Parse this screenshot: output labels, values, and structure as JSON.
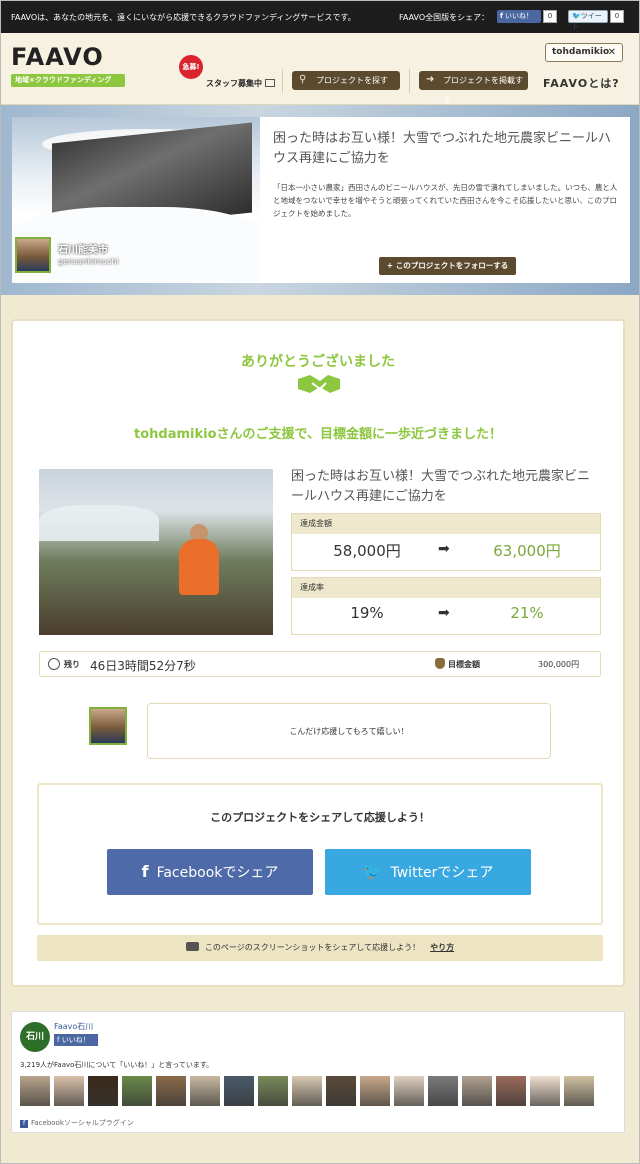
{
  "topbar": {
    "tagline": "FAAVOは、あなたの地元を、遠くにいながら応援できるクラウドファンディングサービスです。",
    "share_label": "FAAVO全国版をシェア：",
    "fb_like": "いいね！",
    "fb_count": "0",
    "tweet": "ツイート",
    "tweet_count": "0"
  },
  "header": {
    "logo": "FAAVO",
    "logo_sub": "地域×クラウドファンディング",
    "badge": "急募!",
    "staff": "スタッフ募集中",
    "find_project": "プロジェクトを探す",
    "post_project": "プロジェクトを掲載する",
    "user": "tohdamikio",
    "close": "✕",
    "faavo_what": "FAAVOとは?"
  },
  "hero": {
    "title": "困った時はお互い様！大雪でつぶれた地元農家ビニールハウス再建にご協力を",
    "description": "「日本一小さい農家」西田さんのビニールハウスが、先日の雪で潰れてしまいました。いつも、農と人と地域をつないで幸せを増やそうと頑張ってくれていた西田さんを今こそ応援したいと思い、このプロジェクトを始めました。",
    "user_name": "石川能美市",
    "user_id": "gensankimuchi",
    "follow": "+ このプロジェクトをフォローする"
  },
  "thanks": {
    "title": "ありがとうございました",
    "message": "tohdamikioさんのご支援で、目標金額に一歩近づきました！",
    "project_title": "困った時はお互い様！大雪でつぶれた地元農家ビニールハウス再建にご協力を",
    "amount_label": "達成金額",
    "amount_from": "58,000円",
    "amount_to": "63,000円",
    "rate_label": "達成率",
    "rate_from": "19%",
    "rate_to": "21%",
    "remain_label": "残り",
    "remain_value": "46日3時間52分7秒",
    "goal_label": "目標金額",
    "goal_value": "300,000円",
    "comment": "こんだけ応援してもろて嬉しい！",
    "share_title": "このプロジェクトをシェアして応援しよう！",
    "fb_share": "Facebookでシェア",
    "tw_share": "Twitterでシェア",
    "screenshot_text": "このページのスクリーンショットをシェアして応援しよう！",
    "how": "やり方"
  },
  "fbplugin": {
    "page_logo": "石川",
    "page_name": "Faavo石川",
    "like": "いいね！",
    "count_text": "3,219人がFaavo石川について「いいね！」と言っています。",
    "footer": "Facebookソーシャルプラグイン",
    "faces": [
      "#b9a58c",
      "#d9c0a8",
      "#3a2a1a",
      "#6a8a4a",
      "#8a6a4a",
      "#c8b8a0",
      "#4a5a6a",
      "#7a8a5a",
      "#d8c8b0",
      "#5a4a3a",
      "#c9a98a",
      "#e0d0c0",
      "#7a7a7a",
      "#b0a090",
      "#9a6a5a",
      "#f0e0d0",
      "#d0c0a0"
    ]
  }
}
